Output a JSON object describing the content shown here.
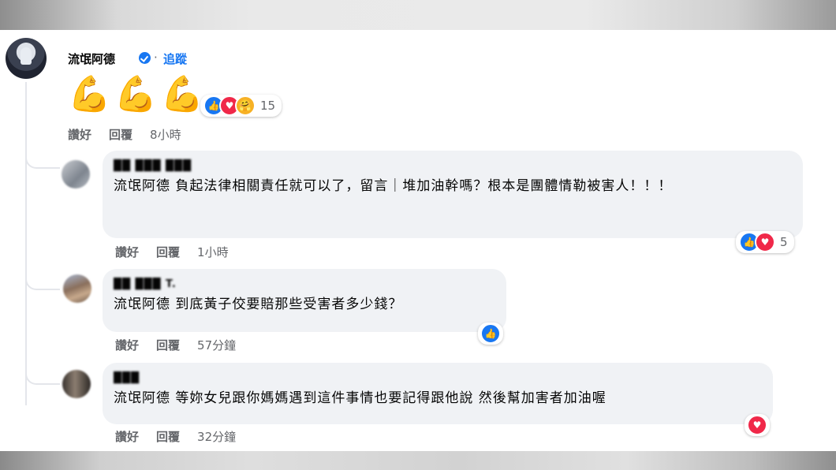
{
  "post": {
    "author": "流氓阿德",
    "verified_icon": "verified-badge-icon",
    "separator": "·",
    "follow": "追蹤",
    "body_emoji": "💪💪💪",
    "reactions": {
      "icons": [
        "like-icon",
        "love-icon",
        "care-icon"
      ],
      "count": "15"
    },
    "actions": {
      "like": "讚好",
      "reply": "回覆",
      "time": "8小時"
    }
  },
  "comments": [
    {
      "author": "██ ███ ███",
      "text": "流氓阿德 負起法律相關責任就可以了，留言｜堆加油幹嗎？根本是團體情勒被害人！！！",
      "reactions": {
        "icons": [
          "like-icon",
          "love-icon"
        ],
        "count": "5"
      },
      "actions": {
        "like": "讚好",
        "reply": "回覆",
        "time": "1小時"
      }
    },
    {
      "author": "██ ███ T.",
      "text": "流氓阿德 到底黃子佼要賠那些受害者多少錢？",
      "reactions": {
        "icons": [
          "like-icon"
        ],
        "count": ""
      },
      "actions": {
        "like": "讚好",
        "reply": "回覆",
        "time": "57分鐘"
      }
    },
    {
      "author": "███",
      "text": "流氓阿德 等妳女兒跟你媽媽遇到這件事情也要記得跟他說 然後幫加害者加油喔",
      "reactions": {
        "icons": [
          "love-icon"
        ],
        "count": ""
      },
      "actions": {
        "like": "讚好",
        "reply": "回覆",
        "time": "32分鐘"
      }
    }
  ],
  "colors": {
    "link": "#1877f2",
    "bubble": "#f0f2f5",
    "meta": "#65676b",
    "like": "#1877f2",
    "love": "#f02849"
  }
}
